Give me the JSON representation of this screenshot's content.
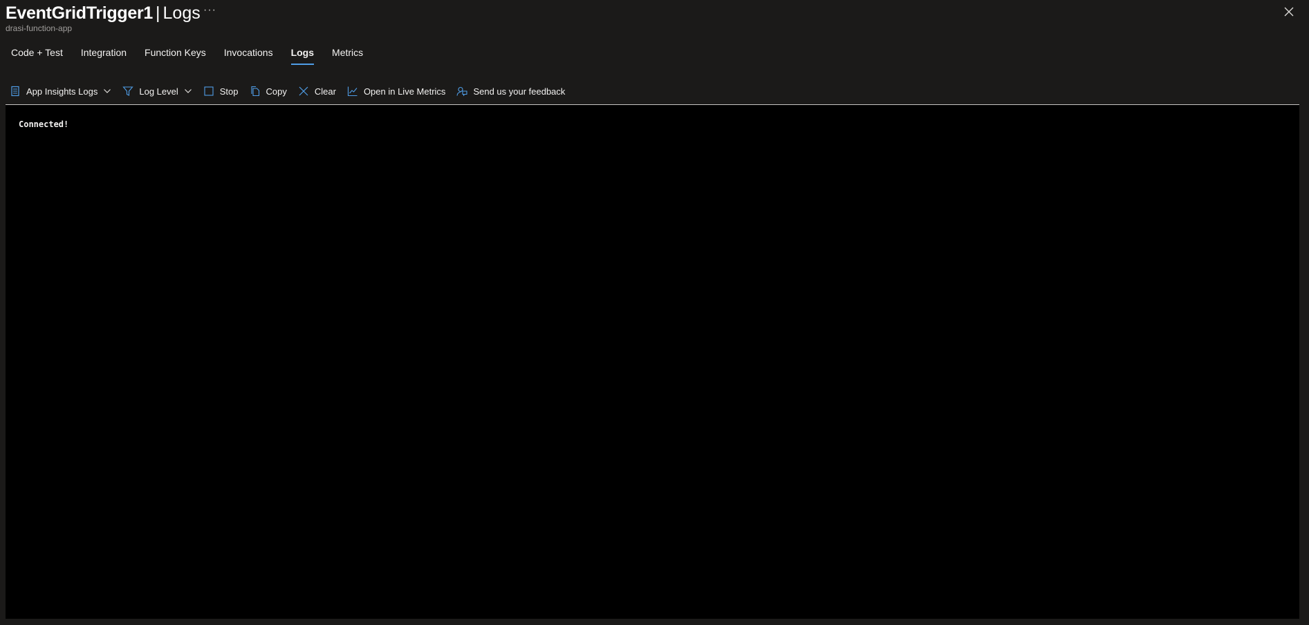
{
  "header": {
    "function_name": "EventGridTrigger1",
    "separator": "|",
    "page_name": "Logs",
    "more_label": "···",
    "subtitle": "drasi-function-app"
  },
  "tabs": [
    {
      "label": "Code + Test",
      "active": false
    },
    {
      "label": "Integration",
      "active": false
    },
    {
      "label": "Function Keys",
      "active": false
    },
    {
      "label": "Invocations",
      "active": false
    },
    {
      "label": "Logs",
      "active": true
    },
    {
      "label": "Metrics",
      "active": false
    }
  ],
  "toolbar": {
    "app_insights": {
      "label": "App Insights Logs",
      "icon": "document-icon"
    },
    "log_level": {
      "label": "Log Level",
      "icon": "filter-icon"
    },
    "stop": {
      "label": "Stop",
      "icon": "stop-icon"
    },
    "copy": {
      "label": "Copy",
      "icon": "copy-icon"
    },
    "clear": {
      "label": "Clear",
      "icon": "clear-icon"
    },
    "live_metrics": {
      "label": "Open in Live Metrics",
      "icon": "chart-line-icon"
    },
    "feedback": {
      "label": "Send us your feedback",
      "icon": "feedback-icon"
    }
  },
  "console": {
    "lines": [
      "Connected!"
    ]
  },
  "colors": {
    "accent": "#4f9ee8",
    "background": "#1b1a19",
    "console_bg": "#000000"
  }
}
